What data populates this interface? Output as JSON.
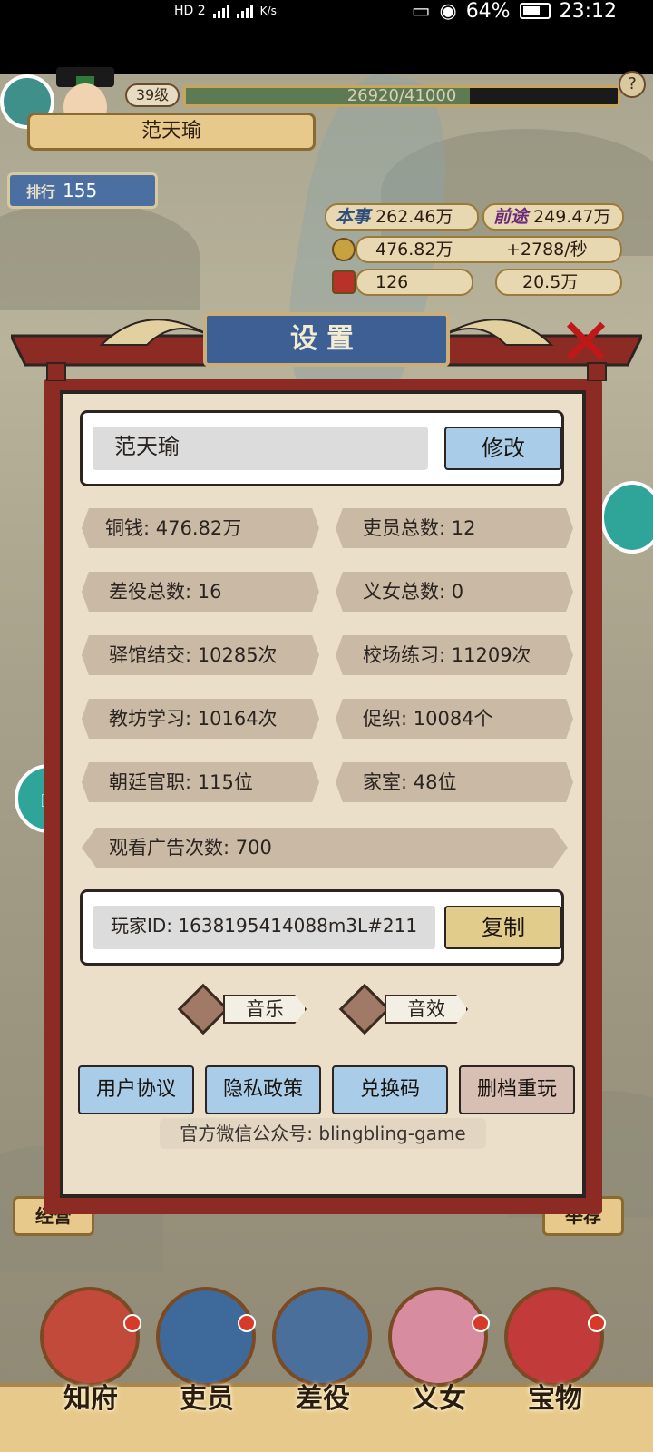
{
  "status_bar": {
    "network_left": "HD 2",
    "network_speed": "K/s",
    "battery": "64%",
    "time": "23:12"
  },
  "player": {
    "name": "范天瑜",
    "level": "39级",
    "exp": "26920/41000",
    "exp_fraction": 0.6566,
    "skill_label": "本事",
    "skill_value": "262.46万",
    "prospect_label": "前途",
    "prospect_value": "249.47万",
    "coins": "476.82万",
    "coins_rate": "+2788/秒",
    "res_a": "126",
    "res_b": "20.5万",
    "rank_label": "排行",
    "rank": "155"
  },
  "side_tabs": {
    "jingying": "经营",
    "tuijian": "举荐"
  },
  "settings": {
    "title": "设置",
    "name_value": "范天瑜",
    "modify_label": "修改",
    "stats": [
      "铜钱: 476.82万",
      "吏员总数: 12",
      "差役总数: 16",
      "义女总数: 0",
      "驿馆结交: 10285次",
      "校场练习: 11209次",
      "教坊学习: 10164次",
      "促织: 10084个",
      "朝廷官职: 115位",
      "家室: 48位",
      "观看广告次数: 700"
    ],
    "player_id": "玩家ID: 1638195414088m3L#211",
    "copy_label": "复制",
    "music_label": "音乐",
    "sfx_label": "音效",
    "buttons": {
      "user_agreement": "用户协议",
      "privacy_policy": "隐私政策",
      "redeem_code": "兑换码",
      "delete_restart": "删档重玩"
    },
    "footer": "官方微信公众号: blingbling-game"
  },
  "bottom_nav": {
    "zhifu": "知府",
    "liyuan": "吏员",
    "chaiyi": "差役",
    "yinv": "义女",
    "baowu": "宝物"
  },
  "colors": {
    "modal_frame": "#8c2a24",
    "paper": "#ecdfca",
    "title_plate": "#3d5f94",
    "button_blue": "#a9cde8",
    "button_gold": "#e2cc8c",
    "close_red": "#c01818"
  }
}
